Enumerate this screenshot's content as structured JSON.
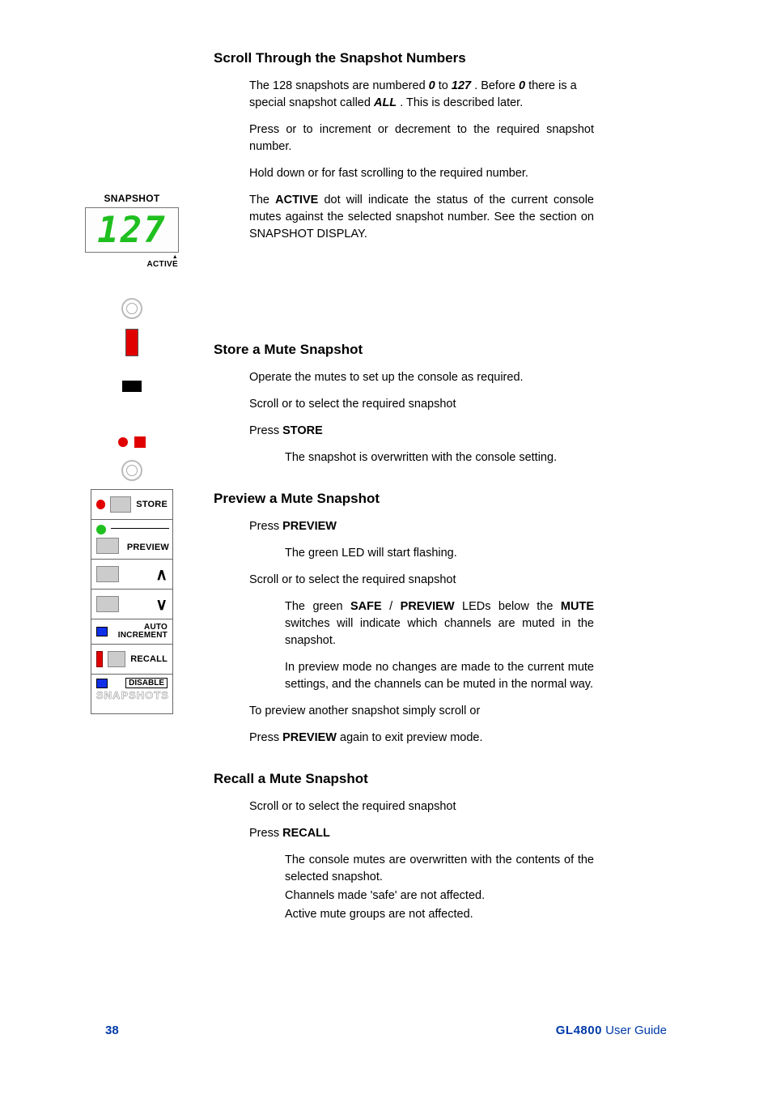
{
  "sections": {
    "scroll": {
      "heading": "Scroll Through the Snapshot Numbers",
      "p1_a": "The 128 snapshots are numbered ",
      "p1_b": "0",
      "p1_c": "  to  ",
      "p1_d": "127",
      "p1_e": "  . Before ",
      "p1_f": "0",
      "p1_g": "  there is a special snapshot called  ",
      "p1_h": "ALL",
      "p1_i": "  . This is described later.",
      "p2": "Press    or    to increment or decrement to the required snapshot number.",
      "p3": "Hold down    or    for fast scrolling to the required number.",
      "p4_a": "The ",
      "p4_b": "ACTIVE",
      "p4_c": " dot will indicate the status of the current console mutes against the selected snapshot number.  See the section on SNAPSHOT DISPLAY."
    },
    "store": {
      "heading": "Store a Mute Snapshot",
      "s1": "Operate the mutes to set up the console as required.",
      "s2": "Scroll    or    to select the required snapshot",
      "s3_a": "Press  ",
      "s3_b": "STORE",
      "s4": "The snapshot is overwritten with the console setting."
    },
    "preview": {
      "heading": "Preview a Mute Snapshot",
      "s1_a": "Press  ",
      "s1_b": "PREVIEW",
      "s2": "The green LED will start flashing.",
      "s3": "Scroll    or    to select the required snapshot",
      "s4_a": "The green ",
      "s4_b": "SAFE",
      "s4_c": "/",
      "s4_d": "PREVIEW",
      "s4_e": " LEDs below the ",
      "s4_f": "MUTE",
      "s4_g": " switches will indicate which channels are muted in the snapshot.",
      "s5": "In preview mode no changes are made to the current mute settings, and the channels can be muted in the normal way.",
      "s6": "To preview another snapshot simply scroll    or",
      "s7_a": "Press  ",
      "s7_b": "PREVIEW",
      "s7_c": "  again to exit preview mode."
    },
    "recall": {
      "heading": "Recall a Mute Snapshot",
      "s1": "Scroll    or    to select the required snapshot",
      "s2_a": "Press  ",
      "s2_b": "RECALL",
      "s3": "The console mutes are overwritten with the contents of the selected snapshot.",
      "s4": "Channels made 'safe' are not affected.",
      "s5": "Active mute groups are not affected."
    }
  },
  "illustration": {
    "snapshot_label": "SNAPSHOT",
    "display_value": "127",
    "active_label": "ACTIVE",
    "panel": {
      "store": "STORE",
      "preview": "PREVIEW",
      "auto_increment": "AUTO INCREMENT",
      "recall": "RECALL",
      "disable": "DISABLE",
      "snapshots": "SNAPSHOTS"
    }
  },
  "footer": {
    "page": "38",
    "brand": "GL4800",
    "guide": " User Guide"
  }
}
